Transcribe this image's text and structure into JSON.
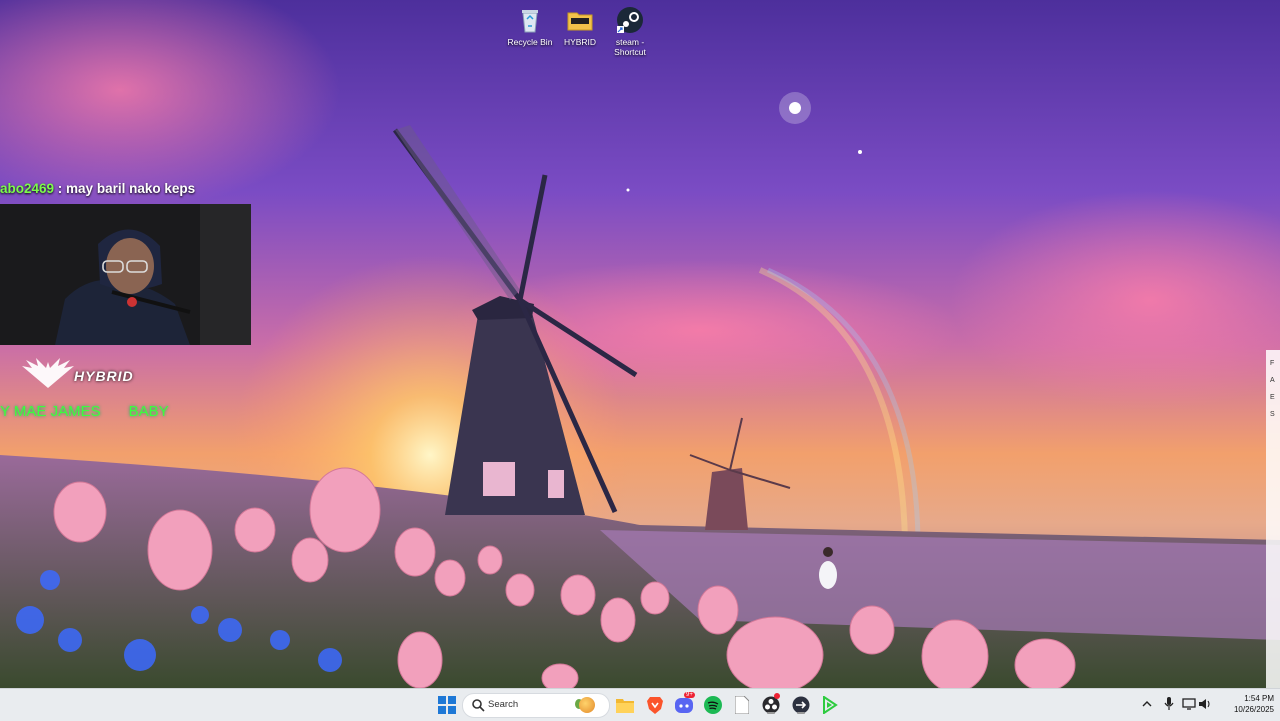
{
  "desktop": {
    "icons": [
      {
        "label": "Recycle Bin",
        "icon": "recycle-bin-icon"
      },
      {
        "label": "HYBRID",
        "icon": "folder-icon"
      },
      {
        "label": "steam - Shortcut",
        "icon": "steam-icon"
      }
    ]
  },
  "overlay": {
    "chat": {
      "user": "abo2469",
      "separator": " : ",
      "message": "may baril nako keps"
    },
    "brand": {
      "name": "HYBRID",
      "logo": "winged-logo-icon"
    },
    "ticker": {
      "left": "Y MAE JAMES",
      "right": "BABY"
    }
  },
  "taskbar": {
    "search_placeholder": "Search",
    "apps": [
      {
        "name": "windows-start",
        "icon": "windows-logo-icon"
      },
      {
        "name": "file-explorer",
        "icon": "folder-icon"
      },
      {
        "name": "brave",
        "icon": "brave-icon"
      },
      {
        "name": "discord",
        "icon": "discord-icon",
        "badge": "9+"
      },
      {
        "name": "spotify",
        "icon": "spotify-icon"
      },
      {
        "name": "document",
        "icon": "document-icon"
      },
      {
        "name": "obs",
        "icon": "obs-icon"
      },
      {
        "name": "app-arrow",
        "icon": "arrow-app-icon"
      },
      {
        "name": "app-green",
        "icon": "green-arrow-icon"
      }
    ],
    "tray": [
      "chevron-up-icon",
      "microphone-icon",
      "display-icon",
      "speaker-icon"
    ],
    "time": "1:54 PM",
    "date": "10/26/2025"
  },
  "colors": {
    "chat_user": "#7cfc4a",
    "ticker": "#3cff3c",
    "taskbar_bg": "#e9ecef"
  }
}
